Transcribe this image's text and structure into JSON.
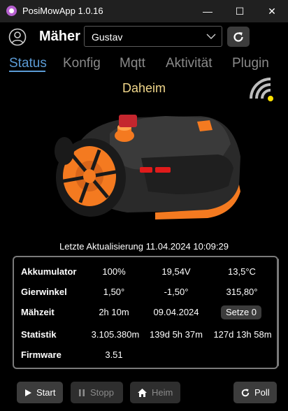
{
  "window": {
    "title": "PosiMowApp 1.0.16",
    "min": "—",
    "max": "☐",
    "close": "✕"
  },
  "header": {
    "mower_label": "Mäher",
    "selected_mower": "Gustav"
  },
  "tabs": [
    {
      "label": "Status",
      "active": true
    },
    {
      "label": "Konfig",
      "active": false
    },
    {
      "label": "Mqtt",
      "active": false
    },
    {
      "label": "Aktivität",
      "active": false
    },
    {
      "label": "Plugin",
      "active": false
    }
  ],
  "status": {
    "state": "Daheim",
    "last_update": "Letzte Aktualisierung  11.04.2024 10:09:29"
  },
  "info": {
    "battery": {
      "label": "Akkumulator",
      "percent": "100%",
      "voltage": "19,54V",
      "temp": "13,5°C"
    },
    "angle": {
      "label": "Gierwinkel",
      "pitch": "1,50°",
      "roll": "-1,50°",
      "yaw": "315,80°"
    },
    "mowtime": {
      "label": "Mähzeit",
      "time": "2h 10m",
      "date": "09.04.2024",
      "reset_label": "Setze 0"
    },
    "stats": {
      "label": "Statistik",
      "distance": "3.105.380m",
      "total": "139d 5h 37m",
      "blade": "127d 13h 58m"
    },
    "firmware": {
      "label": "Firmware",
      "version": "3.51"
    }
  },
  "buttons": {
    "start": "Start",
    "stop": "Stopp",
    "home": "Heim",
    "poll": "Poll"
  },
  "colors": {
    "accent_tab": "#5b9bd5",
    "status_text": "#f0d68a",
    "wifi_strength": "#ffe100",
    "mower_orange": "#f47a20"
  }
}
